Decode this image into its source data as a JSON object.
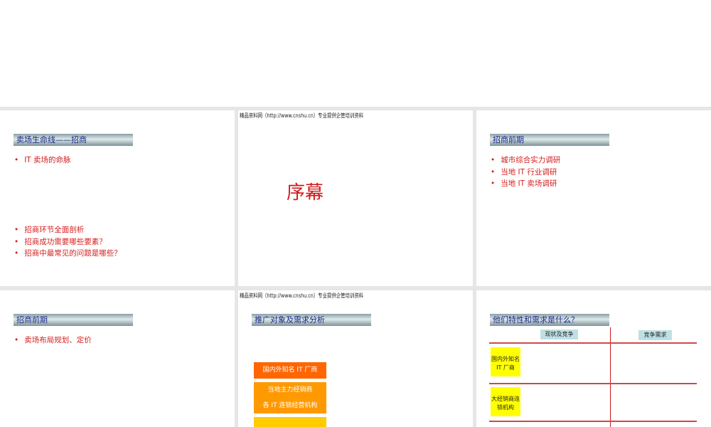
{
  "header_text": "精品资料网（http://www.cnshu.cn）专业提供企管培训资料",
  "slides": [
    {
      "title": "卖场生命线——招商",
      "bullets_top": [
        "IT 卖场的命脉"
      ],
      "bullets_bottom": [
        "招商环节全面剖析",
        "招商成功需要哪些要素？",
        "招商中最常见的问题是哪些？"
      ]
    },
    {
      "big_title": "序幕"
    },
    {
      "title": "招商前期",
      "bullets": [
        "城市综合实力调研",
        "当地 IT 行业调研",
        "当地 IT 卖场调研"
      ]
    },
    {
      "title": "招商前期",
      "bullets": [
        "卖场布局规划、定价"
      ]
    },
    {
      "title": "推广对象及需求分析",
      "boxes": [
        "国内外知名 IT 厂商",
        "当地主力经销商",
        "各 IT 连锁经营机构",
        ""
      ]
    },
    {
      "title": "他们特性和需求是什么？",
      "col_headers": [
        "现状及竞争",
        "竞争需求"
      ],
      "rows": [
        "国内外知名 IT 厂商",
        "大经销商连锁机构"
      ]
    }
  ]
}
